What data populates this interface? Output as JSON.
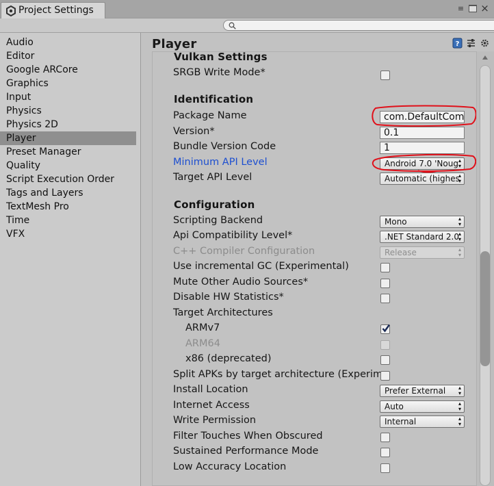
{
  "window": {
    "tab_title": "Project Settings",
    "menu_glyph": "≡",
    "close_glyph": "×"
  },
  "search": {
    "value": ""
  },
  "sidebar": {
    "items": [
      {
        "label": "Audio"
      },
      {
        "label": "Editor"
      },
      {
        "label": "Google ARCore"
      },
      {
        "label": "Graphics"
      },
      {
        "label": "Input"
      },
      {
        "label": "Physics"
      },
      {
        "label": "Physics 2D"
      },
      {
        "label": "Player",
        "selected": true
      },
      {
        "label": "Preset Manager"
      },
      {
        "label": "Quality"
      },
      {
        "label": "Script Execution Order"
      },
      {
        "label": "Tags and Layers"
      },
      {
        "label": "TextMesh Pro"
      },
      {
        "label": "Time"
      },
      {
        "label": "VFX"
      }
    ]
  },
  "panel": {
    "title": "Player",
    "icons": [
      "help-icon",
      "preset-icon",
      "gear-icon"
    ]
  },
  "vulkan": {
    "title": "Vulkan Settings",
    "srgb_label": "SRGB Write Mode*",
    "srgb_checked": false
  },
  "identification": {
    "title": "Identification",
    "package_name_label": "Package Name",
    "package_name_value": "com.DefaultCom",
    "version_label": "Version*",
    "version_value": "0.1",
    "bundle_label": "Bundle Version Code",
    "bundle_value": "1",
    "min_api_label": "Minimum API Level",
    "min_api_value": "Android 7.0 'Noug",
    "target_api_label": "Target API Level",
    "target_api_value": "Automatic (highes"
  },
  "configuration": {
    "title": "Configuration",
    "scripting_backend_label": "Scripting Backend",
    "scripting_backend_value": "Mono",
    "api_compat_label": "Api Compatibility Level*",
    "api_compat_value": ".NET Standard 2.0",
    "cpp_config_label": "C++ Compiler Configuration",
    "cpp_config_value": "Release",
    "incremental_gc_label": "Use incremental GC (Experimental)",
    "incremental_gc_checked": false,
    "mute_audio_label": "Mute Other Audio Sources*",
    "mute_audio_checked": false,
    "disable_hw_label": "Disable HW Statistics*",
    "disable_hw_checked": false,
    "target_arch_label": "Target Architectures",
    "armv7_label": "ARMv7",
    "armv7_checked": true,
    "arm64_label": "ARM64",
    "arm64_checked": false,
    "x86_label": "x86 (deprecated)",
    "x86_checked": false,
    "split_apks_label": "Split APKs by target architecture (Experime",
    "split_apks_checked": false,
    "install_location_label": "Install Location",
    "install_location_value": "Prefer External",
    "internet_access_label": "Internet Access",
    "internet_access_value": "Auto",
    "write_permission_label": "Write Permission",
    "write_permission_value": "Internal",
    "filter_touches_label": "Filter Touches When Obscured",
    "filter_touches_checked": false,
    "sustained_perf_label": "Sustained Performance Mode",
    "sustained_perf_checked": false,
    "low_accuracy_label": "Low Accuracy Location",
    "low_accuracy_checked": false
  },
  "colors": {
    "link_label": "#1d4fd0",
    "annotation_red": "#e0101a",
    "selected_bg": "#8f8f8f",
    "check_mark": "#1a2a55"
  }
}
